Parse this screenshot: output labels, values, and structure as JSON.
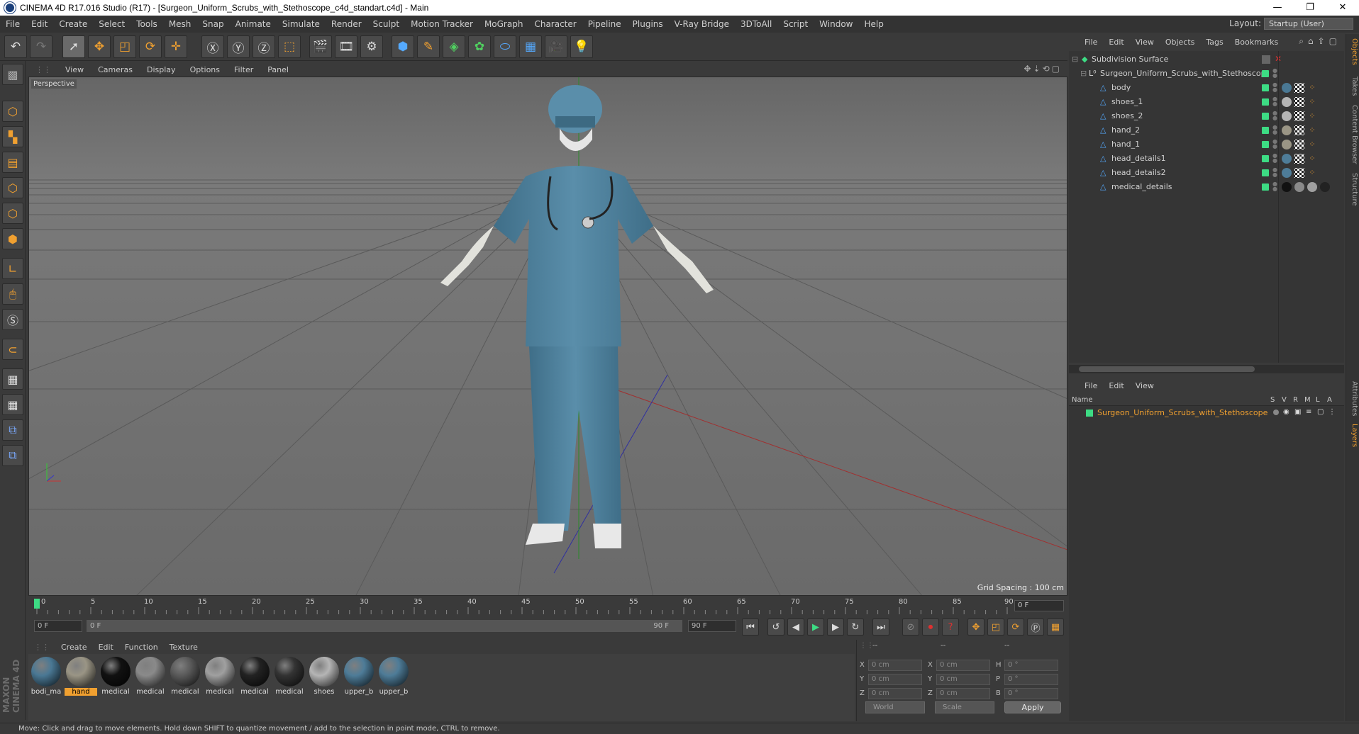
{
  "window": {
    "title": "CINEMA 4D R17.016 Studio (R17) - [Surgeon_Uniform_Scrubs_with_Stethoscope_c4d_standart.c4d] - Main",
    "minimize": "—",
    "restore": "❐",
    "close": "✕"
  },
  "menu": [
    "File",
    "Edit",
    "Create",
    "Select",
    "Tools",
    "Mesh",
    "Snap",
    "Animate",
    "Simulate",
    "Render",
    "Sculpt",
    "Motion Tracker",
    "MoGraph",
    "Character",
    "Pipeline",
    "Plugins",
    "V-Ray Bridge",
    "3DToAll",
    "Script",
    "Window",
    "Help"
  ],
  "layout": {
    "label": "Layout:",
    "value": "Startup (User)"
  },
  "viewport": {
    "menu": [
      "View",
      "Cameras",
      "Display",
      "Options",
      "Filter",
      "Panel"
    ],
    "camera_label": "Perspective",
    "grid_spacing": "Grid Spacing : 100 cm",
    "nav_icons": "✥⇣⟲▢"
  },
  "timeline": {
    "ticks": [
      "0",
      "5",
      "10",
      "15",
      "20",
      "25",
      "30",
      "35",
      "40",
      "45",
      "50",
      "55",
      "60",
      "65",
      "70",
      "75",
      "80",
      "85",
      "90"
    ],
    "current_frame": "0 F"
  },
  "transport": {
    "start_field": "0 F",
    "range_start": "0 F",
    "range_end": "90 F",
    "end_field": "90 F"
  },
  "materials": {
    "menu": [
      "Create",
      "Edit",
      "Function",
      "Texture"
    ],
    "items": [
      {
        "name": "bodi_ma",
        "color": "#4a7894"
      },
      {
        "name": "hand",
        "color": "#9a9585",
        "selected": true
      },
      {
        "name": "medical",
        "color": "#111111"
      },
      {
        "name": "medical",
        "color": "#8a8a8a"
      },
      {
        "name": "medical",
        "color": "#5a5a5a"
      },
      {
        "name": "medical",
        "color": "#a0a0a0"
      },
      {
        "name": "medical",
        "color": "#222222"
      },
      {
        "name": "medical",
        "color": "#333333"
      },
      {
        "name": "shoes",
        "color": "#b5b5b5"
      },
      {
        "name": "upper_b",
        "color": "#4e7c98"
      },
      {
        "name": "upper_b",
        "color": "#4e7c98"
      }
    ]
  },
  "coordinates": {
    "headers": [
      "--",
      "--",
      "--"
    ],
    "rows": [
      {
        "a": "X",
        "av": "0 cm",
        "b": "X",
        "bv": "0 cm",
        "c": "H",
        "cv": "0 °"
      },
      {
        "a": "Y",
        "av": "0 cm",
        "b": "Y",
        "bv": "0 cm",
        "c": "P",
        "cv": "0 °"
      },
      {
        "a": "Z",
        "av": "0 cm",
        "b": "Z",
        "bv": "0 cm",
        "c": "B",
        "cv": "0 °"
      }
    ],
    "mode": "World",
    "scale": "Scale",
    "apply": "Apply"
  },
  "objects": {
    "menu": [
      "File",
      "Edit",
      "View",
      "Objects",
      "Tags",
      "Bookmarks"
    ],
    "root": "Subdivision Surface",
    "group": "Surgeon_Uniform_Scrubs_with_Stethoscop",
    "children": [
      "body",
      "shoes_1",
      "shoes_2",
      "hand_2",
      "hand_1",
      "head_details1",
      "head_details2",
      "medical_details"
    ]
  },
  "layers": {
    "menu": [
      "File",
      "Edit",
      "View"
    ],
    "col_name": "Name",
    "cols": [
      "S",
      "V",
      "R",
      "M",
      "L",
      "A"
    ],
    "item": "Surgeon_Uniform_Scrubs_with_Stethoscope"
  },
  "right_tabs": [
    "Objects",
    "Takes",
    "Content Browser",
    "Structure",
    "Attributes",
    "Layers"
  ],
  "status": "Move: Click and drag to move elements. Hold down SHIFT to quantize movement / add to the selection in point mode, CTRL to remove.",
  "maxon": "MAXON CINEMA 4D"
}
